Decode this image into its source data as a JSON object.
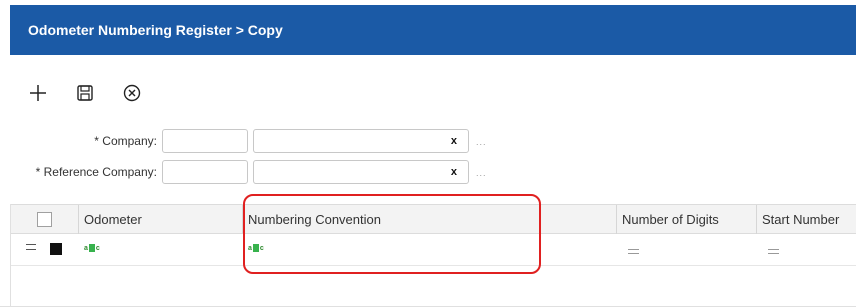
{
  "header": {
    "title": "Odometer Numbering Register > Copy"
  },
  "toolbar": {
    "buttons": [
      {
        "icon": "plus-icon"
      },
      {
        "icon": "save-icon"
      },
      {
        "icon": "cancel-circle-icon"
      }
    ]
  },
  "form": {
    "company_label": "* Company:",
    "company_code_value": "",
    "company_name_value": "",
    "reference_company_label": "* Reference Company:",
    "reference_code_value": "",
    "reference_name_value": "",
    "clear_glyph": "x",
    "lookup_glyph": "..."
  },
  "grid": {
    "columns": [
      "Odometer",
      "Numbering Convention",
      "Number of Digits",
      "Start Number"
    ],
    "rows": [
      {
        "odometer_icon": "abc-text-icon",
        "numbering_convention_icon": "abc-text-icon",
        "number_of_digits": "",
        "start_number": ""
      }
    ]
  },
  "colors": {
    "title_bar": "#1b5aa6",
    "highlight": "#e02020",
    "abc_icon": "#37b24d"
  }
}
